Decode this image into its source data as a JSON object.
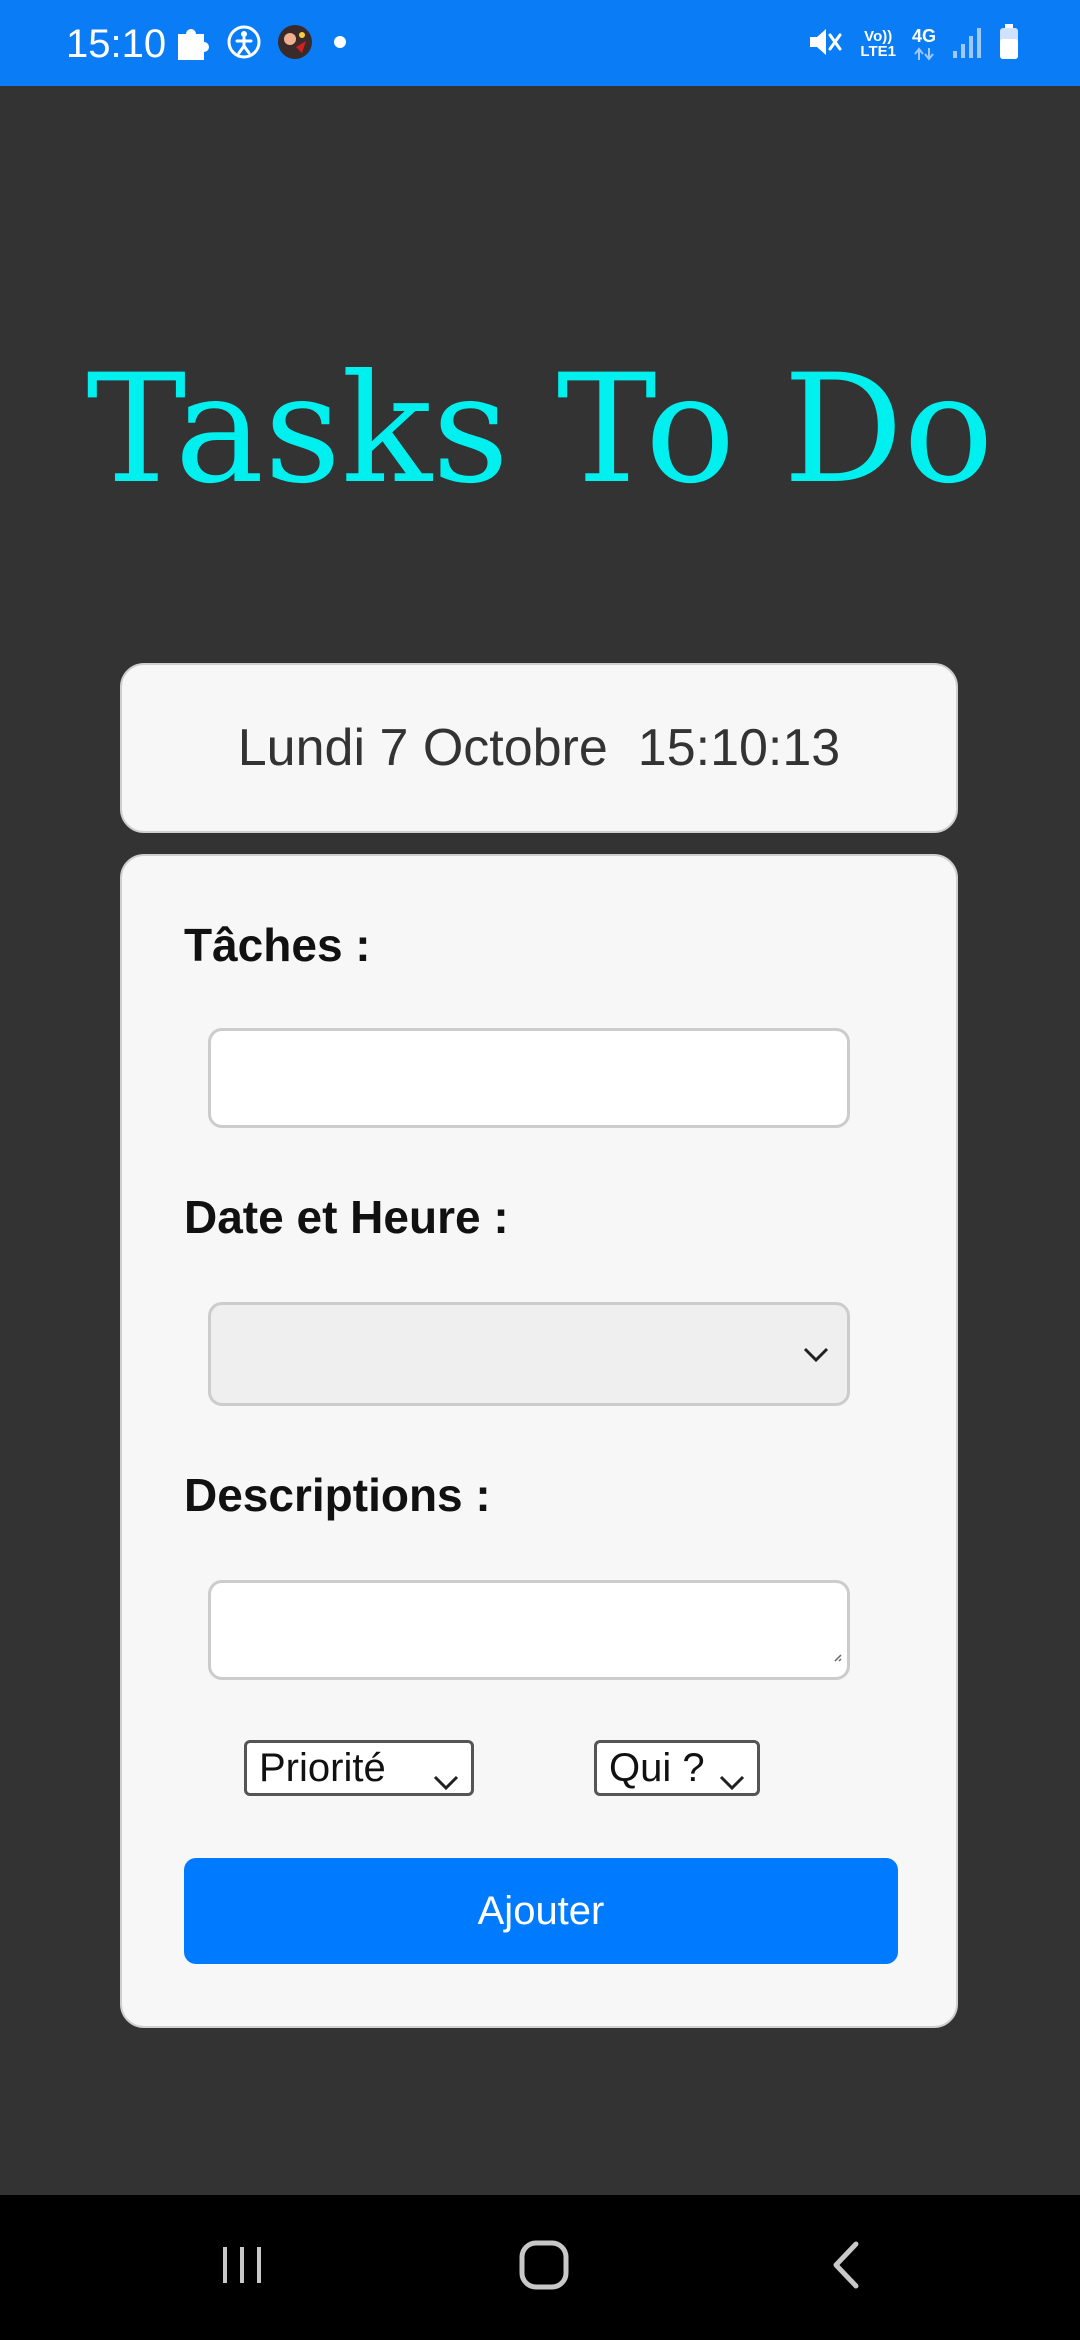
{
  "status_bar": {
    "time": "15:10",
    "network_top": "Vo))",
    "network_bottom": "LTE1",
    "network_type": "4G",
    "icons": [
      "puzzle-icon",
      "accessibility-icon",
      "avatar-icon",
      "dot-icon",
      "mute-icon",
      "signal-icon",
      "battery-icon"
    ]
  },
  "app": {
    "title": "Tasks To Do",
    "title_color": "#00f0f0"
  },
  "clock": {
    "date": "Lundi 7 Octobre",
    "time": "15:10:13"
  },
  "form": {
    "task_label": "Tâches :",
    "task_value": "",
    "datetime_label": "Date et Heure :",
    "datetime_value": "",
    "description_label": "Descriptions :",
    "description_value": "",
    "priority_select": "Priorité",
    "who_select": "Qui ?",
    "submit_label": "Ajouter",
    "accent_color": "#007bff"
  },
  "nav": {
    "icons": [
      "recent-apps-icon",
      "home-icon",
      "back-icon"
    ]
  }
}
